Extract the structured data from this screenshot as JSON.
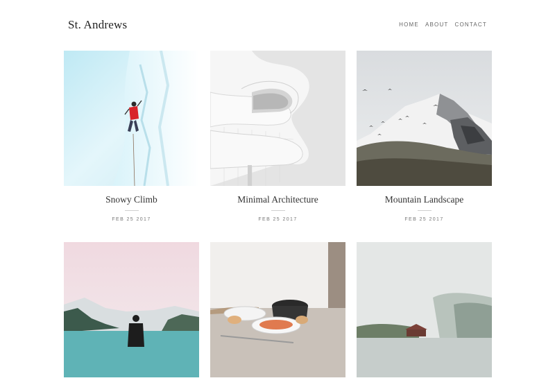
{
  "site": {
    "title": "St. Andrews"
  },
  "nav": {
    "items": [
      "HOME",
      "ABOUT",
      "CONTACT"
    ]
  },
  "posts": [
    {
      "title": "Snowy Climb",
      "date": "FEB 25 2017"
    },
    {
      "title": "Minimal Architecture",
      "date": "FEB 25 2017"
    },
    {
      "title": "Mountain Landscape",
      "date": "FEB 25 2017"
    },
    {
      "title": "",
      "date": ""
    },
    {
      "title": "",
      "date": ""
    },
    {
      "title": "",
      "date": ""
    }
  ]
}
